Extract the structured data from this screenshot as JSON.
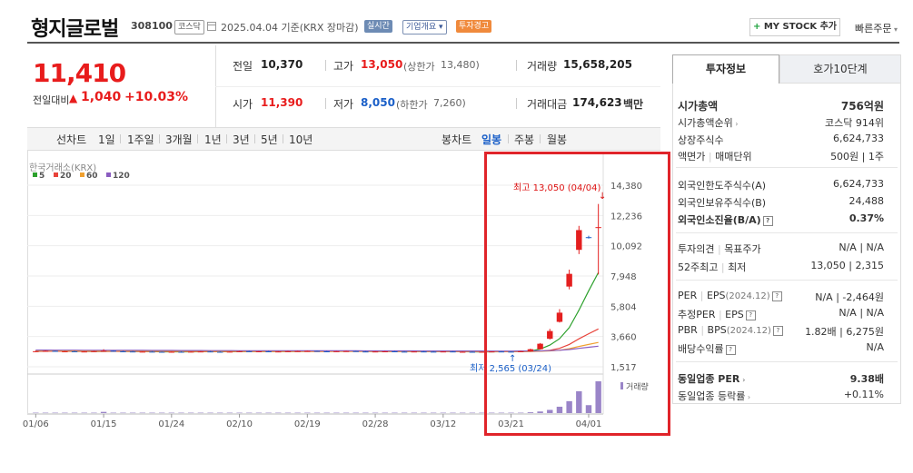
{
  "header": {
    "stock_name": "형지글로벌",
    "stock_code": "308100",
    "market": "코스닥",
    "date": "2025.04.04  기준(KRX 장마감)",
    "realtime": "실시간",
    "company_overview": "기업개요",
    "warning": "투자경고",
    "mystock": "MY STOCK 추가",
    "quick_order": "빠른주문"
  },
  "summary": {
    "price": "11,410",
    "change_label": "전일대비",
    "change_arrow": "▲",
    "change_value": "1,040",
    "change_rate": "+10.03%"
  },
  "quotes": {
    "prev_label": "전일",
    "prev": "10,370",
    "high_label": "고가",
    "high": "13,050",
    "upper_label": "(상한가",
    "upper": "13,480)",
    "volume_label": "거래량",
    "volume": "15,658,205",
    "open_label": "시가",
    "open": "11,390",
    "low_label": "저가",
    "low": "8,050",
    "lower_label": "(하한가",
    "lower": "7,260)",
    "amount_label": "거래대금",
    "amount": "174,623",
    "amount_unit": "백만"
  },
  "chart_tabs": {
    "left": [
      "선차트",
      "1일",
      "1주일",
      "3개월",
      "1년",
      "3년",
      "5년",
      "10년"
    ],
    "right": [
      "봉차트",
      "일봉",
      "주봉",
      "월봉"
    ],
    "selected": "일봉"
  },
  "chart_data": {
    "type": "candlestick",
    "source": "한국거래소(KRX)",
    "ma_legend": [
      {
        "name": "5",
        "color": "#2ca02c"
      },
      {
        "name": "20",
        "color": "#e8433a"
      },
      {
        "name": "60",
        "color": "#f0a030"
      },
      {
        "name": "120",
        "color": "#8a5cc0"
      }
    ],
    "y_ticks": [
      "14,380",
      "12,236",
      "10,092",
      "7,948",
      "5,804",
      "3,660",
      "1,517"
    ],
    "y_tick_values": [
      14380,
      12236,
      10092,
      7948,
      5804,
      3660,
      1517
    ],
    "x_ticks": [
      "01/06",
      "01/15",
      "01/24",
      "02/10",
      "02/19",
      "02/28",
      "03/12",
      "03/21",
      "04/01"
    ],
    "x_tick_index": [
      0,
      7,
      14,
      21,
      28,
      35,
      42,
      49,
      57
    ],
    "high_annotation": "최고 13,050 (04/04)",
    "low_annotation": "최저 2,565 (03/24)",
    "volume_label": "거래량",
    "candles": [
      [
        2600,
        2650,
        2560,
        2620
      ],
      [
        2620,
        2680,
        2590,
        2640
      ],
      [
        2640,
        2660,
        2580,
        2600
      ],
      [
        2600,
        2630,
        2570,
        2610
      ],
      [
        2610,
        2640,
        2580,
        2590
      ],
      [
        2590,
        2620,
        2560,
        2600
      ],
      [
        2600,
        2640,
        2570,
        2620
      ],
      [
        2620,
        2760,
        2600,
        2650
      ],
      [
        2650,
        2680,
        2590,
        2610
      ],
      [
        2610,
        2640,
        2580,
        2600
      ],
      [
        2600,
        2630,
        2560,
        2570
      ],
      [
        2570,
        2610,
        2550,
        2590
      ],
      [
        2590,
        2620,
        2560,
        2580
      ],
      [
        2580,
        2600,
        2540,
        2560
      ],
      [
        2560,
        2600,
        2530,
        2580
      ],
      [
        2580,
        2610,
        2550,
        2570
      ],
      [
        2570,
        2600,
        2540,
        2590
      ],
      [
        2590,
        2620,
        2560,
        2600
      ],
      [
        2600,
        2630,
        2570,
        2580
      ],
      [
        2580,
        2610,
        2550,
        2570
      ],
      [
        2570,
        2600,
        2540,
        2590
      ],
      [
        2590,
        2640,
        2570,
        2620
      ],
      [
        2620,
        2650,
        2580,
        2600
      ],
      [
        2600,
        2630,
        2570,
        2610
      ],
      [
        2610,
        2640,
        2580,
        2590
      ],
      [
        2590,
        2620,
        2560,
        2600
      ],
      [
        2600,
        2640,
        2580,
        2620
      ],
      [
        2620,
        2650,
        2590,
        2630
      ],
      [
        2630,
        2660,
        2600,
        2640
      ],
      [
        2640,
        2660,
        2600,
        2610
      ],
      [
        2610,
        2640,
        2580,
        2600
      ],
      [
        2600,
        2630,
        2570,
        2620
      ],
      [
        2620,
        2650,
        2590,
        2630
      ],
      [
        2630,
        2650,
        2590,
        2600
      ],
      [
        2600,
        2630,
        2570,
        2590
      ],
      [
        2590,
        2620,
        2560,
        2600
      ],
      [
        2600,
        2630,
        2570,
        2610
      ],
      [
        2610,
        2640,
        2580,
        2590
      ],
      [
        2590,
        2620,
        2560,
        2580
      ],
      [
        2580,
        2610,
        2550,
        2600
      ],
      [
        2600,
        2630,
        2570,
        2590
      ],
      [
        2590,
        2620,
        2560,
        2580
      ],
      [
        2580,
        2610,
        2550,
        2600
      ],
      [
        2600,
        2620,
        2560,
        2570
      ],
      [
        2570,
        2600,
        2550,
        2580
      ],
      [
        2580,
        2600,
        2550,
        2560
      ],
      [
        2560,
        2590,
        2540,
        2580
      ],
      [
        2580,
        2610,
        2560,
        2600
      ],
      [
        2600,
        2620,
        2570,
        2590
      ],
      [
        2590,
        2610,
        2565,
        2580
      ],
      [
        2580,
        2640,
        2570,
        2620
      ],
      [
        2620,
        2800,
        2600,
        2760
      ],
      [
        2760,
        3200,
        2740,
        3150
      ],
      [
        3500,
        4200,
        3450,
        4050
      ],
      [
        4700,
        5600,
        4650,
        5350
      ],
      [
        7200,
        8400,
        7000,
        8100
      ],
      [
        9800,
        11500,
        9500,
        11200
      ],
      [
        10700,
        10800,
        10600,
        10650
      ],
      [
        11390,
        13050,
        8050,
        11410
      ]
    ],
    "volumes": [
      1,
      1,
      1,
      1,
      1,
      1,
      1,
      3,
      1,
      1,
      1,
      1,
      1,
      1,
      1,
      1,
      1,
      1,
      1,
      1,
      1,
      1,
      1,
      1,
      1,
      1,
      1,
      1,
      1,
      1,
      1,
      1,
      1,
      1,
      1,
      1,
      1,
      1,
      1,
      1,
      1,
      1,
      1,
      1,
      1,
      1,
      1,
      1,
      1,
      1,
      1,
      2,
      4,
      8,
      16,
      30,
      55,
      20,
      80
    ],
    "ma": {
      "5": [
        2610,
        2615,
        2615,
        2614,
        2612,
        2608,
        2604,
        2612,
        2614,
        2612,
        2600,
        2598,
        2590,
        2580,
        2576,
        2576,
        2576,
        2584,
        2588,
        2586,
        2582,
        2590,
        2596,
        2600,
        2604,
        2606,
        2606,
        2610,
        2618,
        2624,
        2620,
        2620,
        2620,
        2620,
        2610,
        2604,
        2604,
        2604,
        2596,
        2594,
        2594,
        2590,
        2590,
        2588,
        2584,
        2578,
        2574,
        2580,
        2582,
        2584,
        2594,
        2632,
        2774,
        3056,
        3502,
        4290,
        5530,
        6900,
        8200
      ],
      "20": [
        2620,
        2620,
        2619,
        2618,
        2616,
        2614,
        2612,
        2612,
        2611,
        2610,
        2608,
        2606,
        2603,
        2600,
        2598,
        2596,
        2594,
        2594,
        2594,
        2594,
        2594,
        2596,
        2596,
        2598,
        2598,
        2598,
        2600,
        2602,
        2604,
        2606,
        2606,
        2608,
        2608,
        2608,
        2608,
        2606,
        2606,
        2604,
        2602,
        2600,
        2598,
        2596,
        2594,
        2592,
        2590,
        2588,
        2586,
        2586,
        2586,
        2586,
        2588,
        2596,
        2622,
        2690,
        2820,
        3100,
        3500,
        3860,
        4200
      ],
      "60": [
        2650,
        2648,
        2646,
        2644,
        2642,
        2640,
        2638,
        2636,
        2634,
        2632,
        2630,
        2628,
        2626,
        2624,
        2622,
        2620,
        2618,
        2617,
        2616,
        2615,
        2614,
        2614,
        2613,
        2612,
        2612,
        2612,
        2611,
        2611,
        2611,
        2610,
        2610,
        2610,
        2610,
        2609,
        2609,
        2608,
        2608,
        2607,
        2606,
        2605,
        2604,
        2603,
        2602,
        2601,
        2600,
        2599,
        2598,
        2597,
        2597,
        2597,
        2598,
        2602,
        2614,
        2640,
        2690,
        2800,
        2960,
        3100,
        3240
      ],
      "120": [
        2700,
        2698,
        2696,
        2694,
        2692,
        2690,
        2688,
        2686,
        2684,
        2682,
        2680,
        2678,
        2676,
        2674,
        2672,
        2670,
        2668,
        2666,
        2664,
        2662,
        2660,
        2658,
        2657,
        2656,
        2655,
        2654,
        2653,
        2652,
        2651,
        2650,
        2649,
        2648,
        2647,
        2646,
        2645,
        2644,
        2643,
        2642,
        2641,
        2640,
        2639,
        2638,
        2637,
        2636,
        2635,
        2634,
        2633,
        2632,
        2632,
        2632,
        2633,
        2636,
        2644,
        2660,
        2690,
        2740,
        2820,
        2900,
        2980
      ]
    }
  },
  "panel": {
    "tab_invest": "투자정보",
    "tab_hoga": "호가10단계",
    "market_cap_label": "시가총액",
    "market_cap": "756억원",
    "market_cap_rank_label": "시가총액순위",
    "market_cap_rank": "코스닥 914위",
    "shares_label": "상장주식수",
    "shares": "6,624,733",
    "par_label": "액면가",
    "unit_label": "매매단위",
    "par_unit": "500원  |  1주",
    "foreign_limit_label": "외국인한도주식수(A)",
    "foreign_limit": "6,624,733",
    "foreign_hold_label": "외국인보유주식수(B)",
    "foreign_hold": "24,488",
    "foreign_rate_label": "외국인소진율(B/A)",
    "foreign_rate": "0.37%",
    "opinion_label": "투자의견",
    "target_label": "목표주가",
    "opinion_target": "N/A  |  N/A",
    "w52_label": "52주최고",
    "w52_low_label": "최저",
    "w52": "13,050  |  2,315",
    "per_label": "PER",
    "eps_label": "EPS",
    "eps_year": "(2024.12)",
    "per_eps": "N/A  |  -2,464원",
    "est_per_label": "추정PER",
    "est_eps_label": "EPS",
    "est_per_eps": "N/A  |  N/A",
    "pbr_label": "PBR",
    "bps_label": "BPS",
    "bps_year": "(2024.12)",
    "pbr_bps": "1.82배  |  6,275원",
    "div_label": "배당수익률",
    "div": "N/A",
    "ind_per_label": "동일업종 PER",
    "ind_per": "9.38배",
    "ind_rate_label": "동일업종 등락률",
    "ind_rate": "+0.11%"
  }
}
